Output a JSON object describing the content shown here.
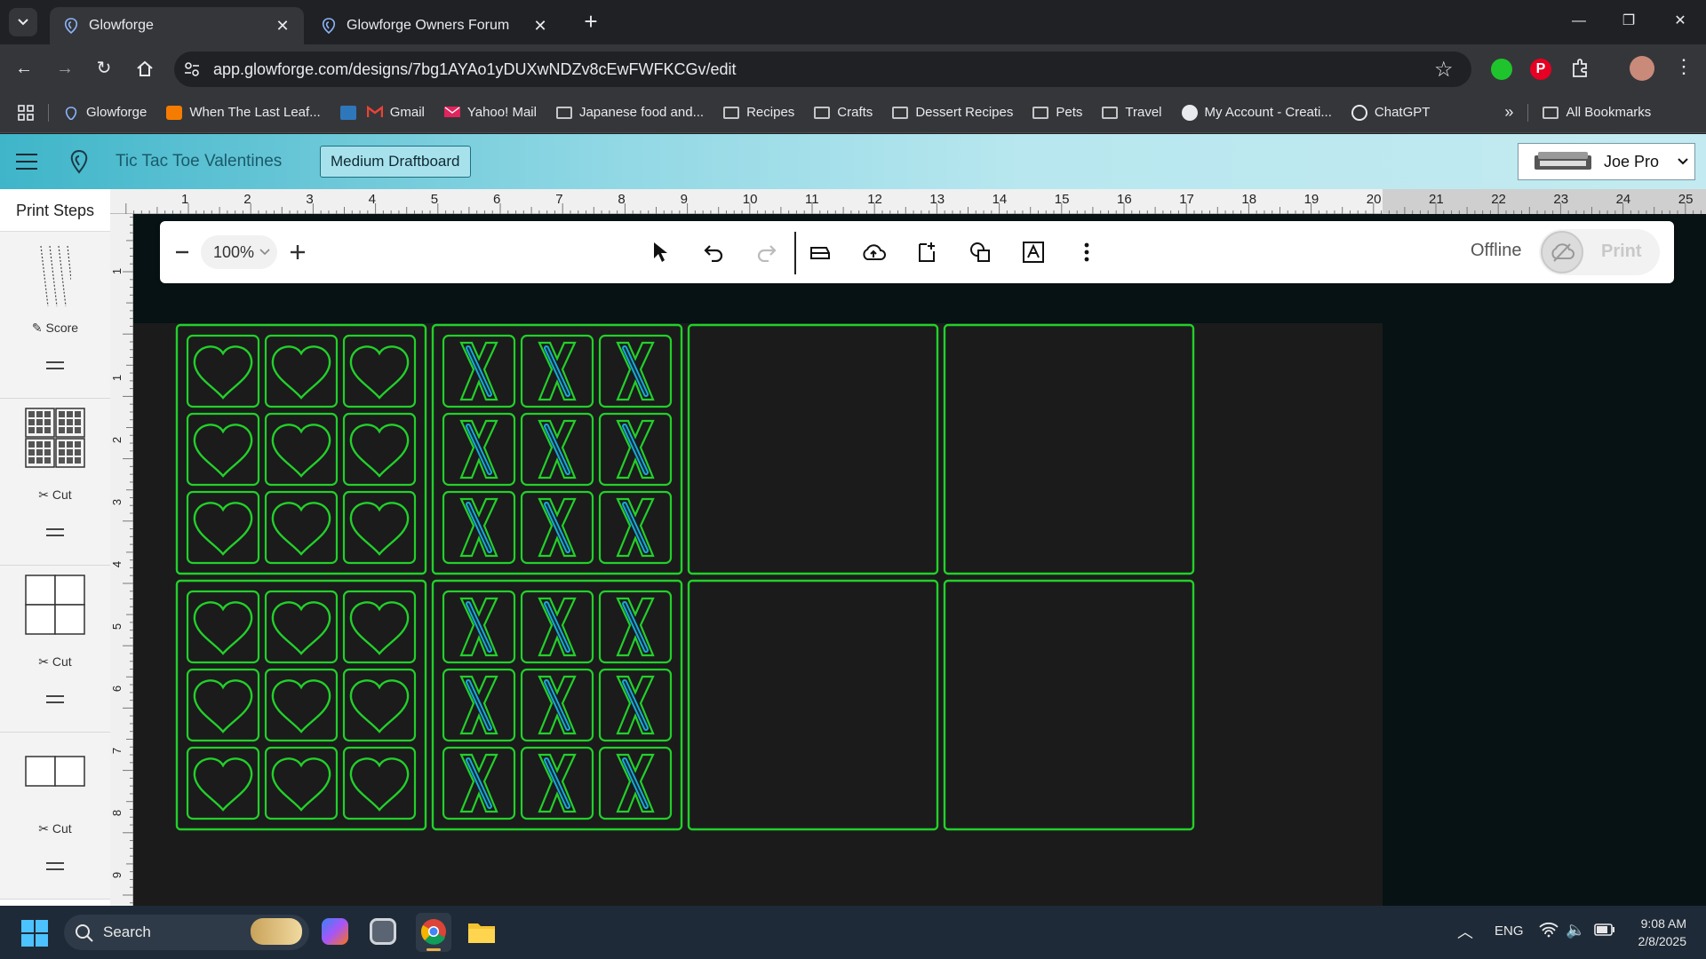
{
  "browser": {
    "tabs": [
      {
        "title": "Glowforge",
        "active": true
      },
      {
        "title": "Glowforge Owners Forum",
        "active": false
      }
    ],
    "url": "app.glowforge.com/designs/7bg1AYAo1yDUXwNDZv8cEwFWFKCGv/edit",
    "bookmarks": [
      {
        "label": "Glowforge",
        "icon": "glowforge-icon"
      },
      {
        "label": "When The Last Leaf...",
        "icon": "blogger-icon"
      },
      {
        "label": "",
        "icon": "amex-icon"
      },
      {
        "label": "Gmail",
        "icon": "gmail-icon"
      },
      {
        "label": "Yahoo! Mail",
        "icon": "yahoo-mail-icon"
      },
      {
        "label": "Japanese food and...",
        "icon": "folder-icon"
      },
      {
        "label": "Recipes",
        "icon": "folder-icon"
      },
      {
        "label": "Crafts",
        "icon": "folder-icon"
      },
      {
        "label": "Dessert Recipes",
        "icon": "folder-icon"
      },
      {
        "label": "Pets",
        "icon": "folder-icon"
      },
      {
        "label": "Travel",
        "icon": "folder-icon"
      },
      {
        "label": "My Account - Creati...",
        "icon": "cricut-icon"
      },
      {
        "label": "ChatGPT",
        "icon": "chatgpt-icon"
      }
    ],
    "all_bookmarks": "All Bookmarks",
    "more": "»"
  },
  "app": {
    "design_title": "Tic Tac Toe Valentines",
    "material": "Medium Draftboard",
    "machine": "Joe Pro",
    "print_steps_title": "Print Steps",
    "steps": [
      {
        "label": "Score"
      },
      {
        "label": "Cut"
      },
      {
        "label": "Cut"
      },
      {
        "label": "Cut"
      }
    ],
    "zoom": "100%",
    "status": "Offline",
    "print_label": "Print",
    "ruler_top": [
      "1",
      "2",
      "3",
      "4",
      "5",
      "6",
      "7",
      "8",
      "9",
      "10",
      "11",
      "12",
      "13",
      "14",
      "15",
      "16",
      "17",
      "18",
      "19",
      "20",
      "21",
      "22",
      "23",
      "24",
      "25"
    ],
    "ruler_left": [
      "1",
      "1",
      "2",
      "3",
      "4",
      "5",
      "6",
      "7",
      "8",
      "9"
    ],
    "colors": {
      "cut_line": "#22d02a",
      "score_line": "#1aa7d6",
      "header_accent": "#3fb5c9"
    }
  },
  "taskbar": {
    "search_label": "Search",
    "language": "ENG",
    "time": "9:08 AM",
    "date": "2/8/2025"
  }
}
